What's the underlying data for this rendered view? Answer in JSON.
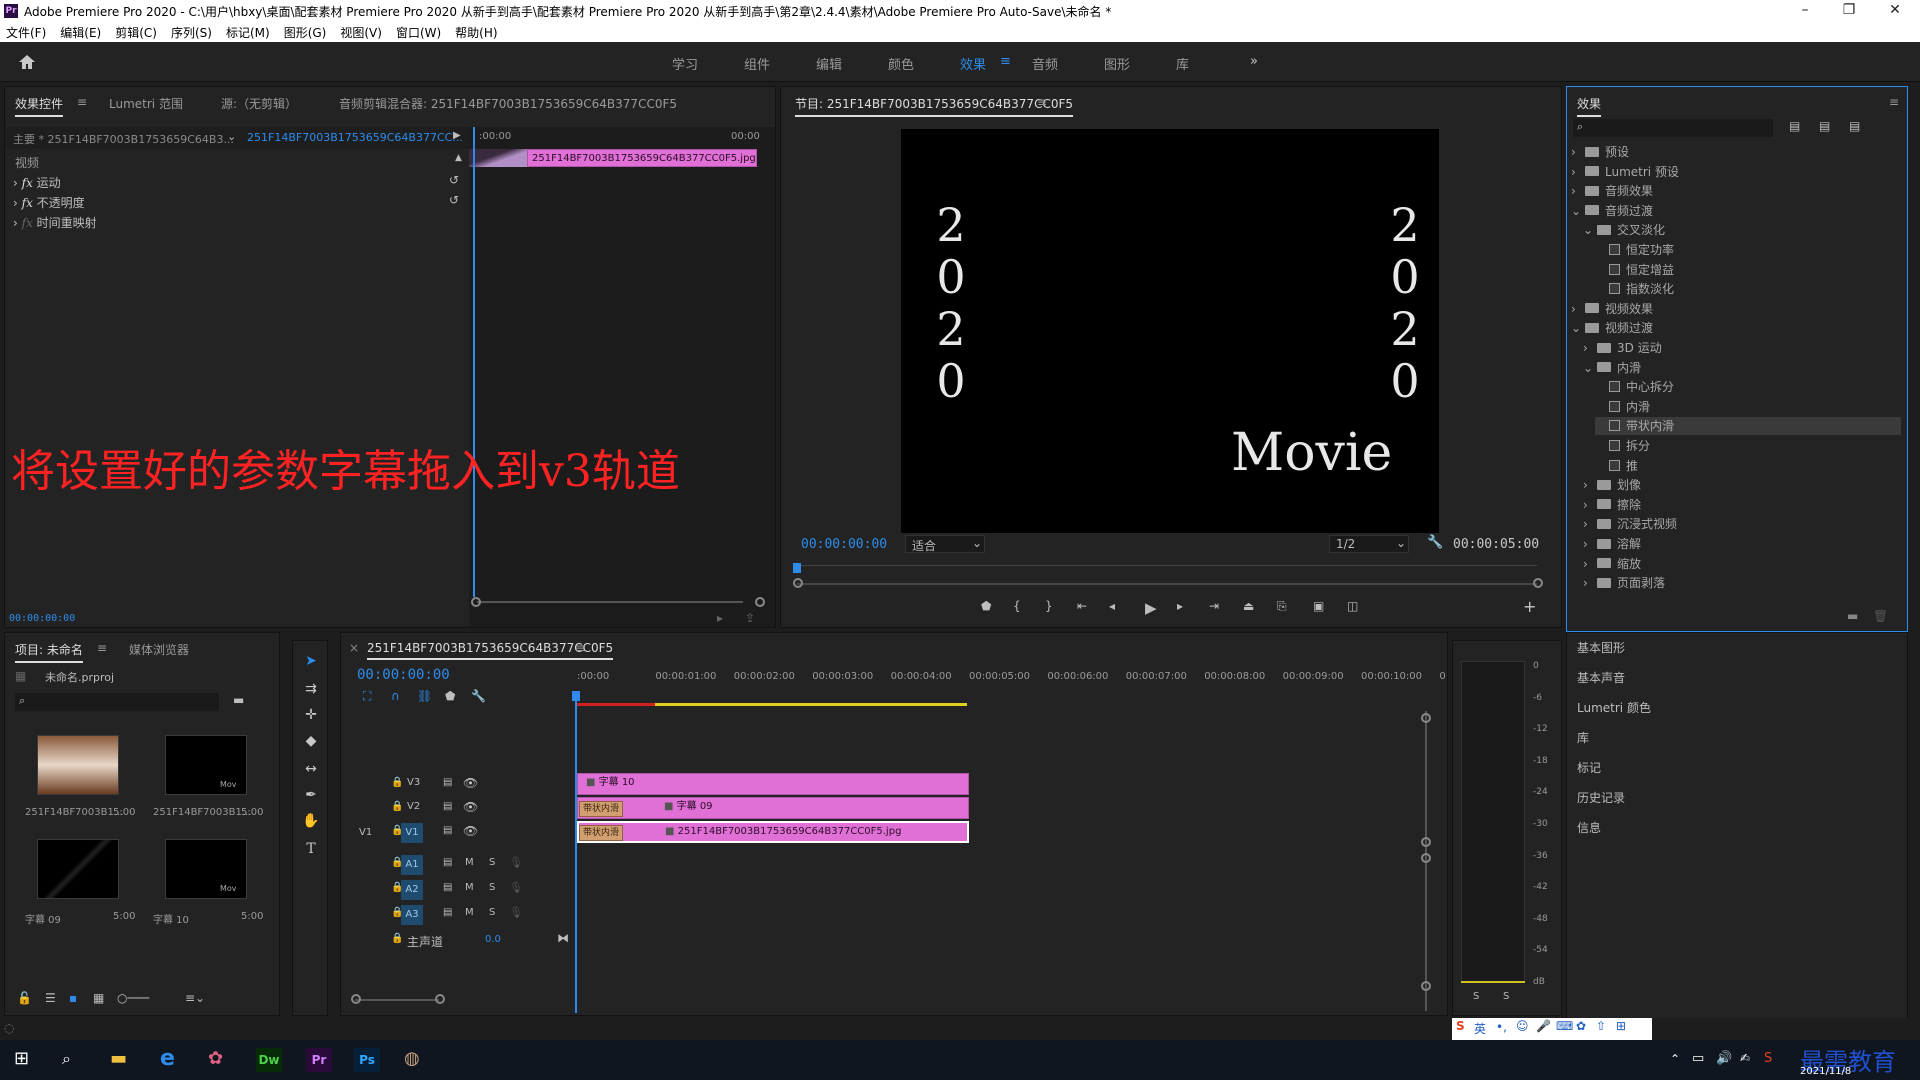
{
  "window": {
    "title": "Adobe Premiere Pro 2020 - C:\\用户\\hbxy\\桌面\\配套素材 Premiere Pro 2020 从新手到高手\\配套素材 Premiere Pro 2020 从新手到高手\\第2章\\2.4.4\\素材\\Adobe Premiere Pro Auto-Save\\未命名 *",
    "minimize": "–",
    "maximize": "❐",
    "close": "✕"
  },
  "menu": [
    "文件(F)",
    "编辑(E)",
    "剪辑(C)",
    "序列(S)",
    "标记(M)",
    "图形(G)",
    "视图(V)",
    "窗口(W)",
    "帮助(H)"
  ],
  "workspaces": {
    "items": [
      "学习",
      "组件",
      "编辑",
      "颜色",
      "效果",
      "音频",
      "图形",
      "库"
    ],
    "active": "效果",
    "more": "»"
  },
  "effect_controls": {
    "tabs": [
      "效果控件",
      "Lumetri 范围",
      "源:（无剪辑）",
      "音频剪辑混合器: 251F14BF7003B1753659C64B377CC0F5"
    ],
    "master": "主要 * 251F14BF7003B1753659C64B3...",
    "clip": "251F14BF7003B1753659C64B377CC...",
    "time_start": ":00:00",
    "time_end": "00:00",
    "clip_label": "251F14BF7003B1753659C64B377CC0F5.jpg",
    "section": "视频",
    "props": [
      "运动",
      "不透明度",
      "时间重映射"
    ],
    "timecode": "00:00:00:00"
  },
  "overlay_caption": "将设置好的参数字幕拖入到v3轨道",
  "program": {
    "title": "节目: 251F14BF7003B1753659C64B377CC0F5",
    "menu_icon": "≡",
    "video_left": [
      "2",
      "0",
      "2",
      "0"
    ],
    "video_right": [
      "2",
      "0",
      "2",
      "0"
    ],
    "video_movie": "Movie",
    "timecode": "00:00:00:00",
    "fit": "适合",
    "quality": "1/2",
    "duration": "00:00:05:00"
  },
  "effects_panel": {
    "title": "效果",
    "tree": [
      {
        "label": "预设",
        "indent": 0,
        "kind": "folder",
        "open": false
      },
      {
        "label": "Lumetri 预设",
        "indent": 0,
        "kind": "folder",
        "open": false
      },
      {
        "label": "音频效果",
        "indent": 0,
        "kind": "folder",
        "open": false
      },
      {
        "label": "音频过渡",
        "indent": 0,
        "kind": "folder",
        "open": true
      },
      {
        "label": "交叉淡化",
        "indent": 1,
        "kind": "folder",
        "open": true
      },
      {
        "label": "恒定功率",
        "indent": 2,
        "kind": "fx"
      },
      {
        "label": "恒定增益",
        "indent": 2,
        "kind": "fx"
      },
      {
        "label": "指数淡化",
        "indent": 2,
        "kind": "fx"
      },
      {
        "label": "视频效果",
        "indent": 0,
        "kind": "folder",
        "open": false
      },
      {
        "label": "视频过渡",
        "indent": 0,
        "kind": "folder",
        "open": true
      },
      {
        "label": "3D 运动",
        "indent": 1,
        "kind": "folder",
        "open": false
      },
      {
        "label": "内滑",
        "indent": 1,
        "kind": "folder",
        "open": true
      },
      {
        "label": "中心拆分",
        "indent": 2,
        "kind": "fx"
      },
      {
        "label": "内滑",
        "indent": 2,
        "kind": "fx"
      },
      {
        "label": "带状内滑",
        "indent": 2,
        "kind": "fx",
        "selected": true
      },
      {
        "label": "拆分",
        "indent": 2,
        "kind": "fx"
      },
      {
        "label": "推",
        "indent": 2,
        "kind": "fx"
      },
      {
        "label": "划像",
        "indent": 1,
        "kind": "folder",
        "open": false
      },
      {
        "label": "擦除",
        "indent": 1,
        "kind": "folder",
        "open": false
      },
      {
        "label": "沉浸式视频",
        "indent": 1,
        "kind": "folder",
        "open": false
      },
      {
        "label": "溶解",
        "indent": 1,
        "kind": "folder",
        "open": false
      },
      {
        "label": "缩放",
        "indent": 1,
        "kind": "folder",
        "open": false
      },
      {
        "label": "页面剥落",
        "indent": 1,
        "kind": "folder",
        "open": false
      }
    ]
  },
  "side_panels": [
    "基本图形",
    "基本声音",
    "Lumetri 颜色",
    "库",
    "标记",
    "历史记录",
    "信息"
  ],
  "project": {
    "tabs": [
      "项目: 未命名",
      "媒体浏览器"
    ],
    "file": "未命名.prproj",
    "items": [
      {
        "name": "251F14BF7003B1...",
        "dur": "5:00"
      },
      {
        "name": "251F14BF7003B1...",
        "dur": "5:00"
      },
      {
        "name": "字幕 09",
        "dur": "5:00"
      },
      {
        "name": "字幕 10",
        "dur": "5:00"
      }
    ]
  },
  "timeline": {
    "tab": "251F14BF7003B1753659C64B377CC0F5",
    "timecode": "00:00:00:00",
    "ruler": [
      ":00:00",
      "00:00:01:00",
      "00:00:02:00",
      "00:00:03:00",
      "00:00:04:00",
      "00:00:05:00",
      "00:00:06:00",
      "00:00:07:00",
      "00:00:08:00",
      "00:00:09:00",
      "00:00:10:00",
      "0"
    ],
    "video_tracks": [
      "V3",
      "V2",
      "V1"
    ],
    "source_v1": "V1",
    "audio_tracks": [
      "A1",
      "A2",
      "A3"
    ],
    "m": "M",
    "s": "S",
    "master": "主声道",
    "master_val": "0.0",
    "clip_v3": "字幕 10",
    "clip_v2": "字幕 09",
    "clip_v1": "251F14BF7003B1753659C64B377CC0F5.jpg",
    "transition": "带状内滑"
  },
  "meter": {
    "ticks": [
      "0",
      "-6",
      "-12",
      "-18",
      "-24",
      "-30",
      "-36",
      "-42",
      "-48",
      "-54",
      "dB"
    ],
    "solo": [
      "S",
      "S"
    ]
  },
  "ime": {
    "lang": "英",
    "punct": "•,"
  },
  "taskbar": {
    "date": "2021/11/8",
    "watermark": "最需教育"
  }
}
